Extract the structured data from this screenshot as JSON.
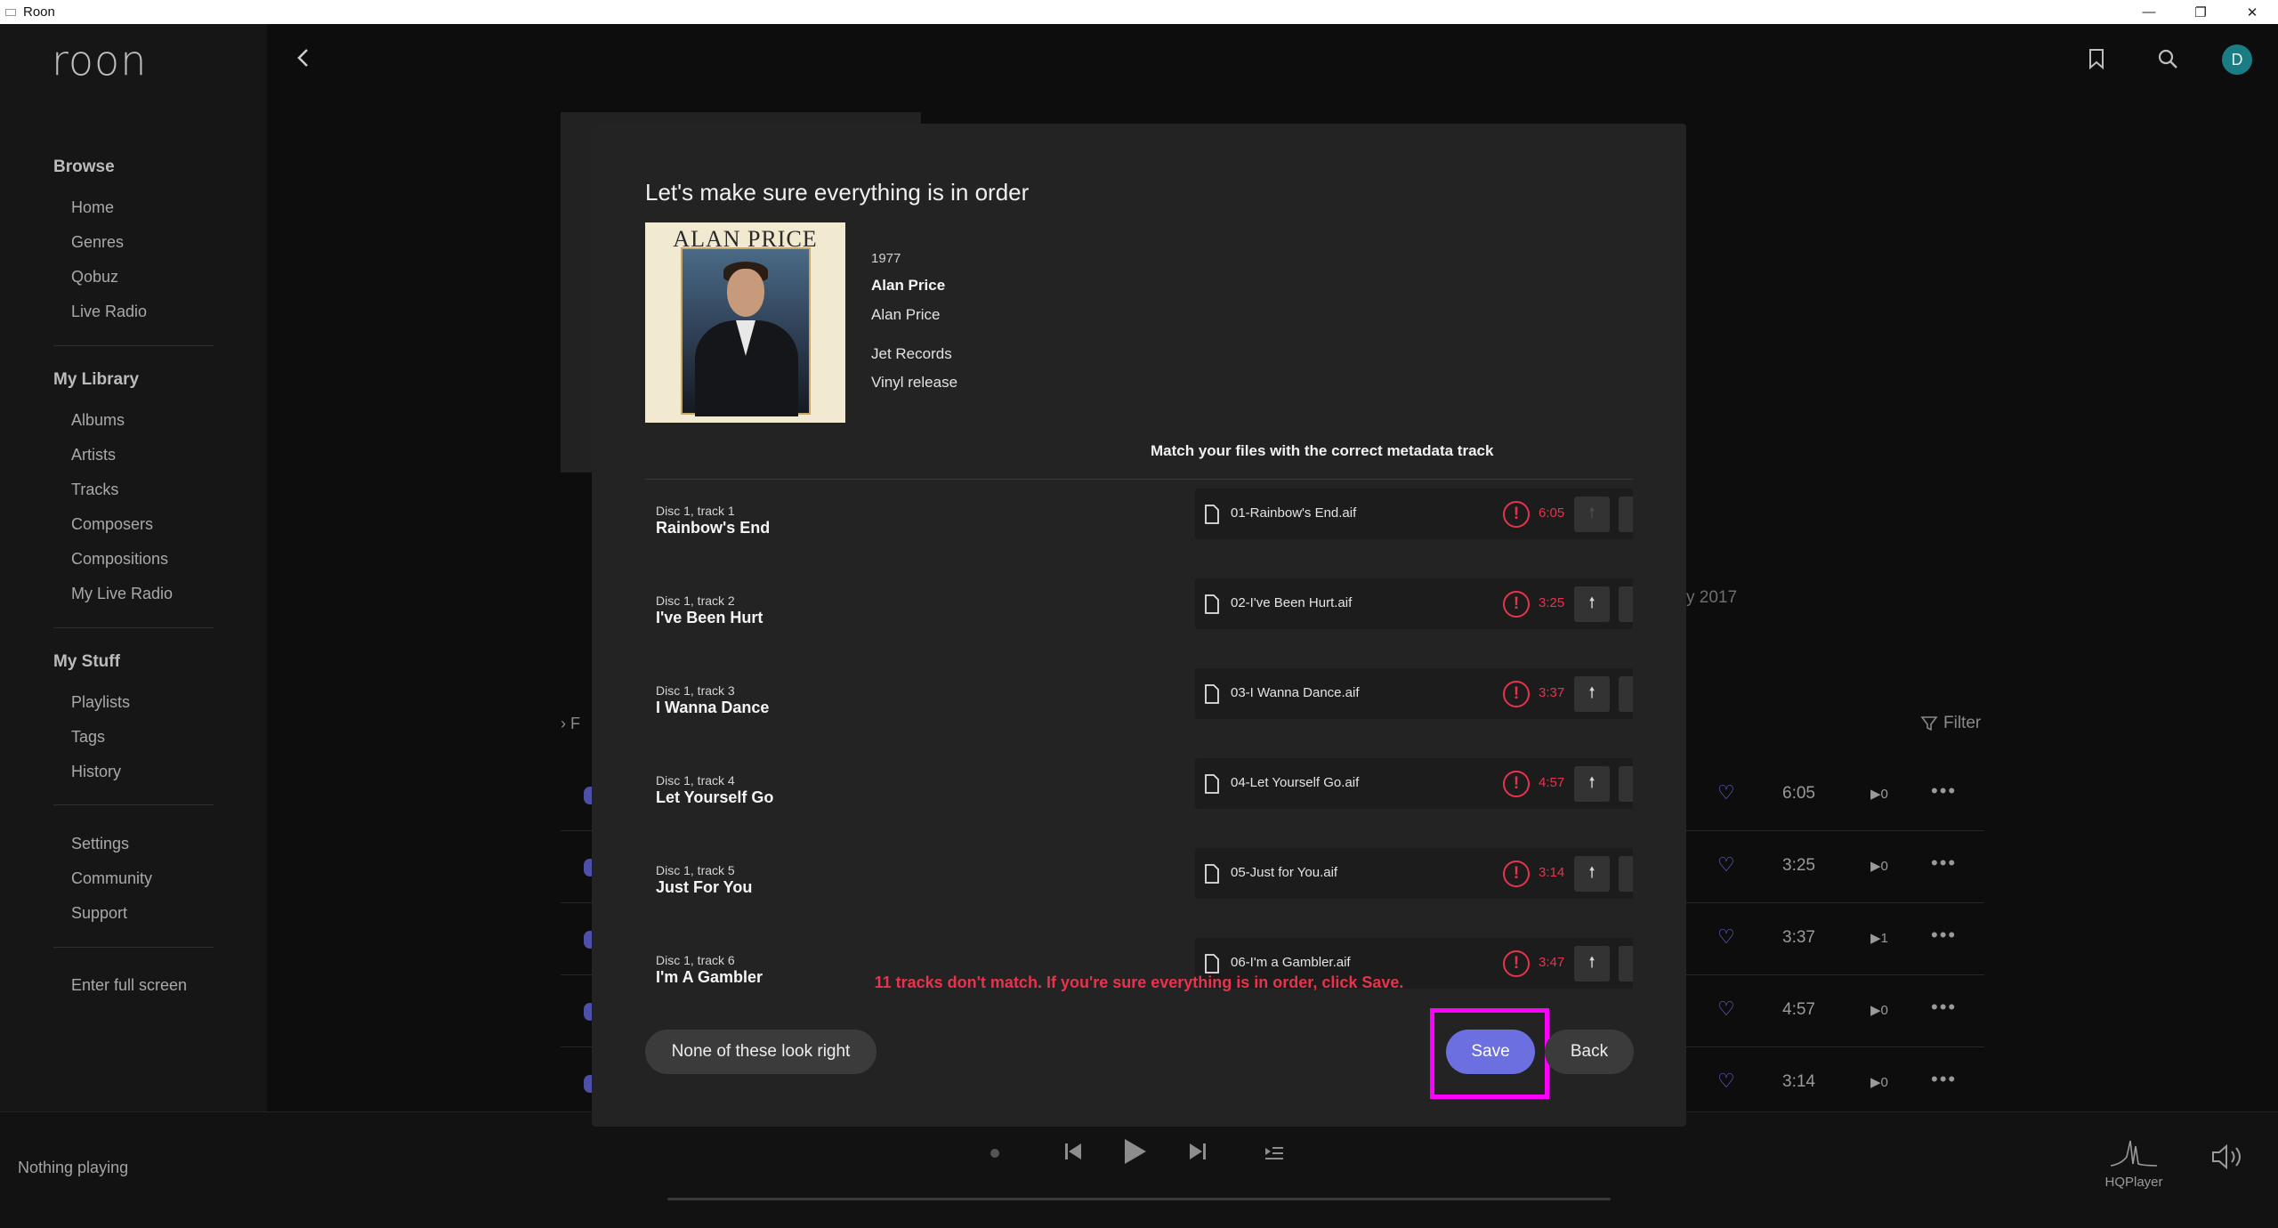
{
  "window": {
    "title": "Roon",
    "minimize": "—",
    "restore": "❐",
    "close": "✕"
  },
  "sidebar": {
    "logo": "roon",
    "sections": [
      {
        "label": "Browse"
      },
      {
        "label": "My Library"
      },
      {
        "label": "My Stuff"
      }
    ],
    "browse_items": [
      "Home",
      "Genres",
      "Qobuz",
      "Live Radio"
    ],
    "library_items": [
      "Albums",
      "Artists",
      "Tracks",
      "Composers",
      "Compositions",
      "My Live Radio"
    ],
    "stuff_items": [
      "Playlists",
      "Tags",
      "History"
    ],
    "footer_items": [
      "Settings",
      "Community",
      "Support"
    ],
    "fullscreen": "Enter full screen"
  },
  "topbar": {
    "avatar_letter": "D",
    "icons": [
      "back-chevron-icon",
      "bookmark-icon",
      "search-icon"
    ]
  },
  "background": {
    "year_fragment": "y 2017",
    "filter_label": "Filter",
    "f_fragment": "F",
    "rows": [
      {
        "duration": "6:05",
        "plays": "▶0"
      },
      {
        "duration": "3:25",
        "plays": "▶0"
      },
      {
        "duration": "3:37",
        "plays": "▶1"
      },
      {
        "duration": "4:57",
        "plays": "▶0"
      },
      {
        "duration": "3:14",
        "plays": "▶0"
      }
    ]
  },
  "player": {
    "now_playing": "Nothing playing",
    "zone_name": "HQPlayer"
  },
  "modal": {
    "title": "Let's make sure everything is in order",
    "cover_text": "ALAN PRICE",
    "year": "1977",
    "album": "Alan Price",
    "artist": "Alan Price",
    "label": "Jet Records",
    "release": "Vinyl release",
    "match_header": "Match your files with the correct metadata track",
    "tracks": [
      {
        "num": "Disc 1, track 1",
        "title": "Rainbow's End",
        "file": "01-Rainbow's End.aif",
        "duration": "6:05"
      },
      {
        "num": "Disc 1, track 2",
        "title": "I've Been Hurt",
        "file": "02-I've Been Hurt.aif",
        "duration": "3:25"
      },
      {
        "num": "Disc 1, track 3",
        "title": "I Wanna Dance",
        "file": "03-I Wanna Dance.aif",
        "duration": "3:37"
      },
      {
        "num": "Disc 1, track 4",
        "title": "Let Yourself Go",
        "file": "04-Let Yourself Go.aif",
        "duration": "4:57"
      },
      {
        "num": "Disc 1, track 5",
        "title": "Just For You",
        "file": "05-Just for You.aif",
        "duration": "3:14"
      },
      {
        "num": "Disc 1, track 6",
        "title": "I'm A Gambler",
        "file": "06-I'm a Gambler.aif",
        "duration": "3:47"
      }
    ],
    "warning": "11 tracks don't match. If you're sure everything is in order, click Save.",
    "none_button": "None of these look right",
    "save_button": "Save",
    "back_button": "Back",
    "warn_glyph": "!",
    "up_glyph": "🠕",
    "down_glyph": "🠗"
  },
  "colors": {
    "accent": "#6b6fe0",
    "error": "#e8334d",
    "highlight": "#ff00ff",
    "avatar": "#1b7d84"
  }
}
